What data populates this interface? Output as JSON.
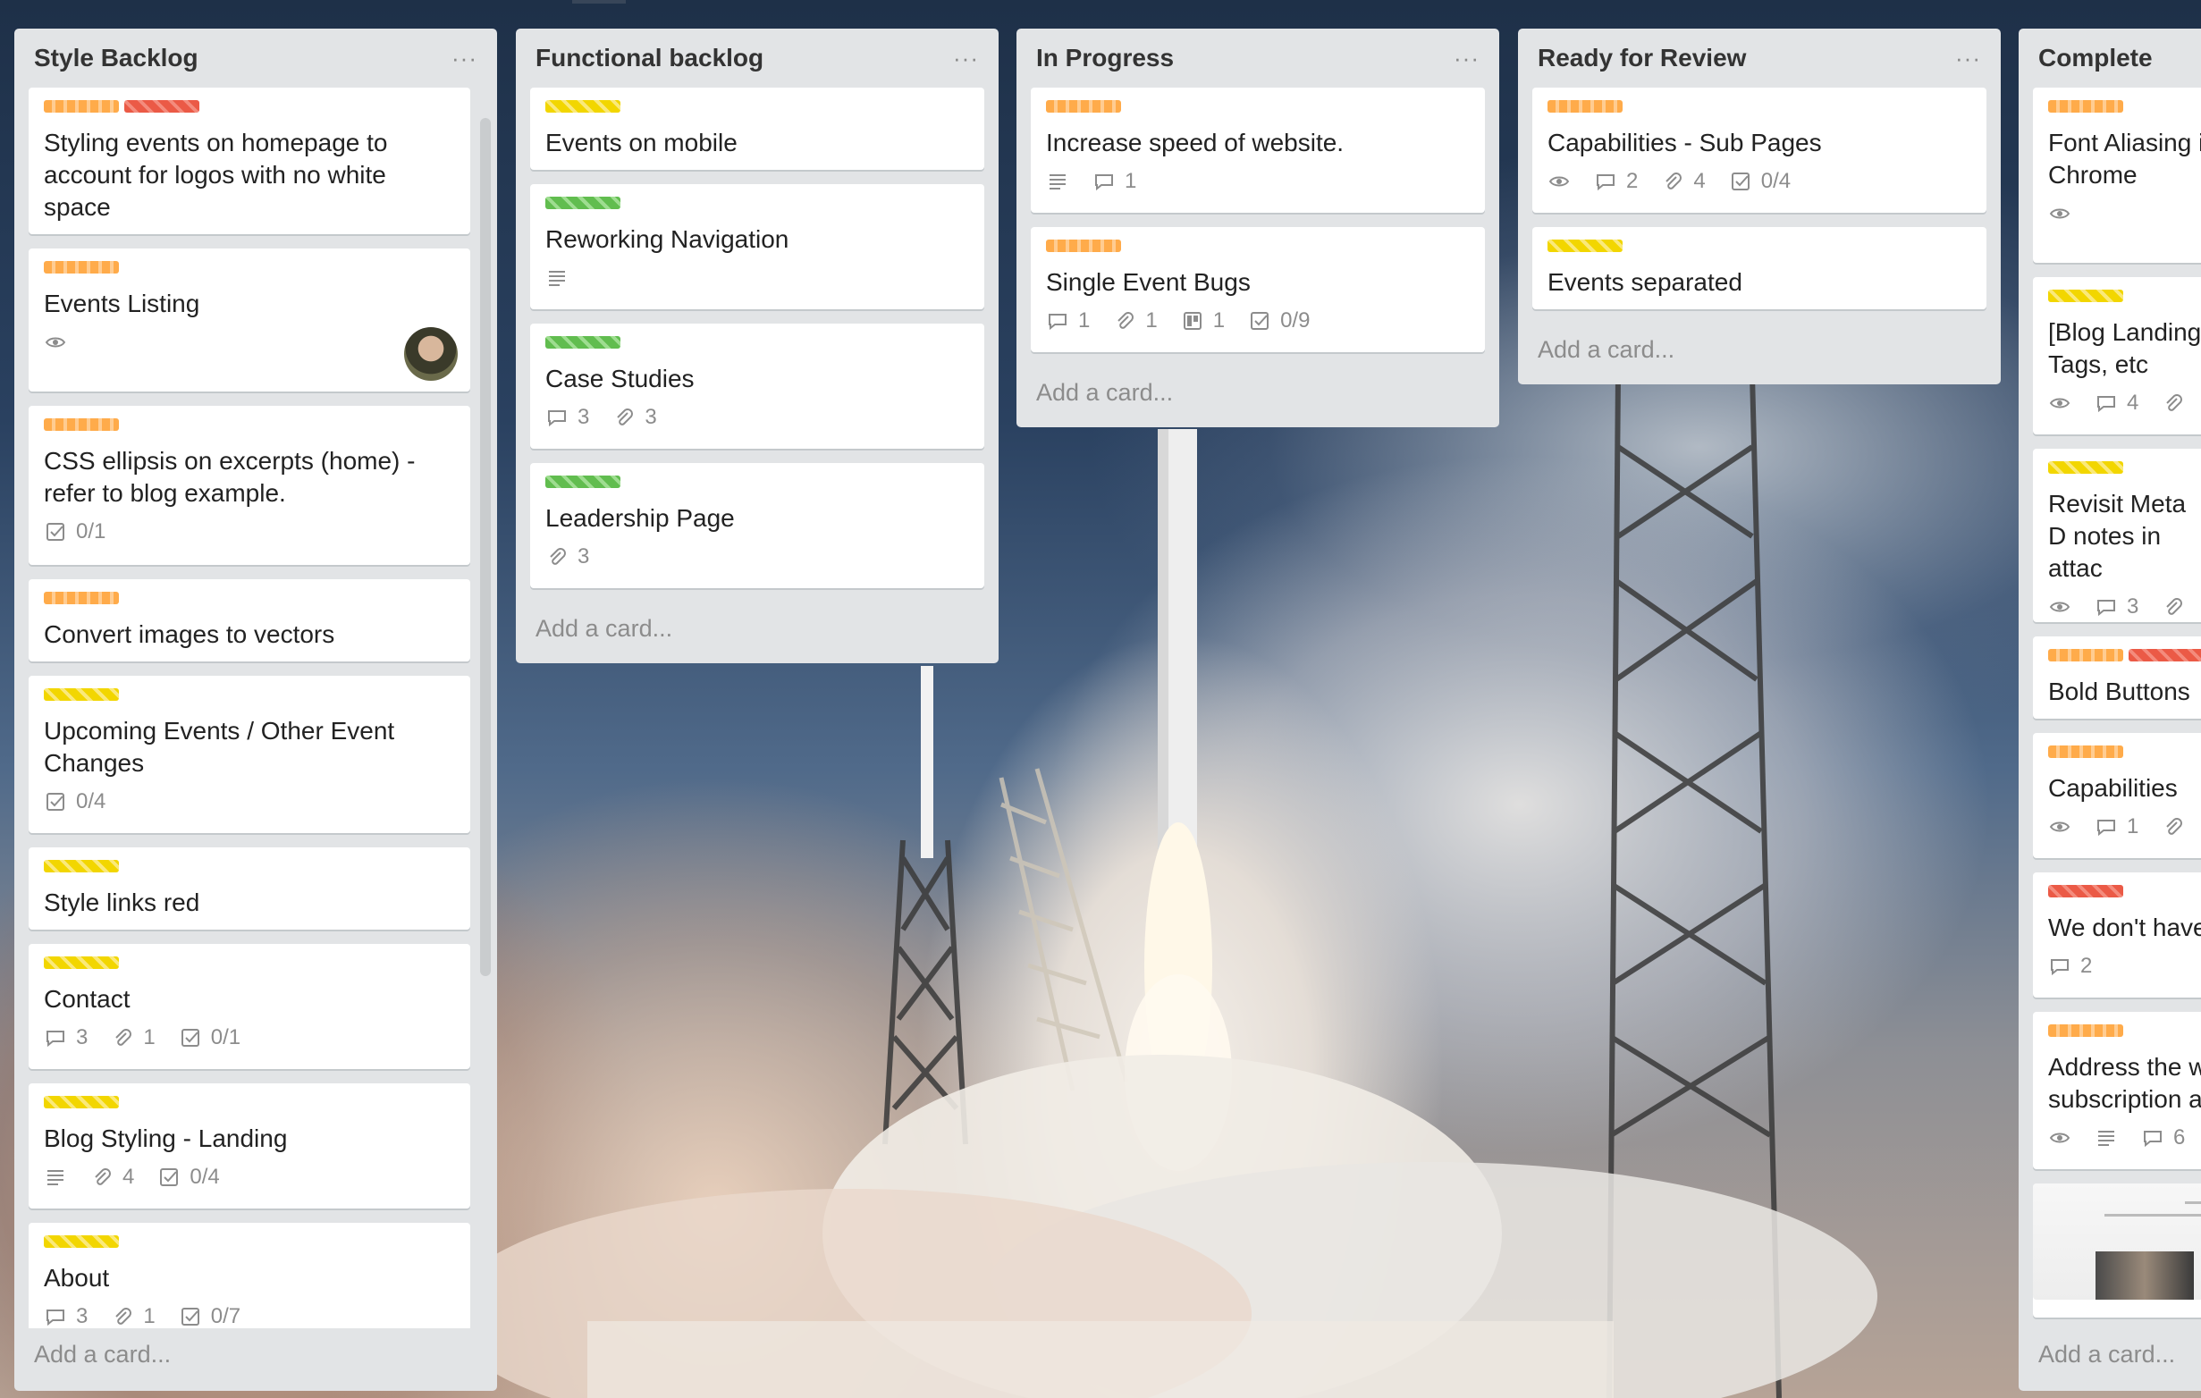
{
  "lists": [
    {
      "title": "Style Backlog",
      "menu": "···",
      "add_card": "Add a card...",
      "cards": [
        {
          "labels": [
            "orange",
            "red"
          ],
          "title": "Styling events on homepage to account for logos with no white space",
          "badges": []
        },
        {
          "labels": [
            "orange"
          ],
          "title": "Events Listing",
          "badges": [
            {
              "icon": "eye-icon",
              "count": ""
            }
          ],
          "avatar": true
        },
        {
          "labels": [
            "orange"
          ],
          "title": "CSS ellipsis on excerpts (home) - refer to blog example.",
          "badges": [
            {
              "icon": "checklist-icon",
              "count": "0/1"
            }
          ]
        },
        {
          "labels": [
            "orange"
          ],
          "title": "Convert images to vectors",
          "badges": []
        },
        {
          "labels": [
            "yellow"
          ],
          "title": "Upcoming Events / Other Event Changes",
          "badges": [
            {
              "icon": "checklist-icon",
              "count": "0/4"
            }
          ]
        },
        {
          "labels": [
            "yellow"
          ],
          "title": "Style links red",
          "badges": []
        },
        {
          "labels": [
            "yellow"
          ],
          "title": "Contact",
          "badges": [
            {
              "icon": "comment-icon",
              "count": "3"
            },
            {
              "icon": "attachment-icon",
              "count": "1"
            },
            {
              "icon": "checklist-icon",
              "count": "0/1"
            }
          ]
        },
        {
          "labels": [
            "yellow"
          ],
          "title": "Blog Styling - Landing",
          "badges": [
            {
              "icon": "description-icon",
              "count": ""
            },
            {
              "icon": "attachment-icon",
              "count": "4"
            },
            {
              "icon": "checklist-icon",
              "count": "0/4"
            }
          ]
        },
        {
          "labels": [
            "yellow"
          ],
          "title": "About",
          "badges": [
            {
              "icon": "comment-icon",
              "count": "3"
            },
            {
              "icon": "attachment-icon",
              "count": "1"
            },
            {
              "icon": "checklist-icon",
              "count": "0/7"
            }
          ]
        }
      ]
    },
    {
      "title": "Functional backlog",
      "menu": "···",
      "add_card": "Add a card...",
      "cards": [
        {
          "labels": [
            "yellow"
          ],
          "title": "Events on mobile",
          "badges": []
        },
        {
          "labels": [
            "green"
          ],
          "title": "Reworking Navigation",
          "badges": [
            {
              "icon": "description-icon",
              "count": ""
            }
          ]
        },
        {
          "labels": [
            "green"
          ],
          "title": "Case Studies",
          "badges": [
            {
              "icon": "comment-icon",
              "count": "3"
            },
            {
              "icon": "attachment-icon",
              "count": "3"
            }
          ]
        },
        {
          "labels": [
            "green"
          ],
          "title": "Leadership Page",
          "badges": [
            {
              "icon": "attachment-icon",
              "count": "3"
            }
          ]
        }
      ]
    },
    {
      "title": "In Progress",
      "menu": "···",
      "add_card": "Add a card...",
      "cards": [
        {
          "labels": [
            "orange"
          ],
          "title": "Increase speed of website.",
          "badges": [
            {
              "icon": "description-icon",
              "count": ""
            },
            {
              "icon": "comment-icon",
              "count": "1"
            }
          ]
        },
        {
          "labels": [
            "orange"
          ],
          "title": "Single Event Bugs",
          "badges": [
            {
              "icon": "comment-icon",
              "count": "1"
            },
            {
              "icon": "attachment-icon",
              "count": "1"
            },
            {
              "icon": "board-icon",
              "count": "1"
            },
            {
              "icon": "checklist-icon",
              "count": "0/9"
            }
          ]
        }
      ]
    },
    {
      "title": "Ready for Review",
      "menu": "···",
      "add_card": "Add a card...",
      "cards": [
        {
          "labels": [
            "orange"
          ],
          "title": "Capabilities - Sub Pages",
          "badges": [
            {
              "icon": "eye-icon",
              "count": ""
            },
            {
              "icon": "comment-icon",
              "count": "2"
            },
            {
              "icon": "attachment-icon",
              "count": "4"
            },
            {
              "icon": "checklist-icon",
              "count": "0/4"
            }
          ]
        },
        {
          "labels": [
            "yellow"
          ],
          "title": "Events separated",
          "badges": []
        }
      ]
    },
    {
      "title": "Complete",
      "menu": "···",
      "add_card": "Add a card...",
      "cards": [
        {
          "labels": [
            "orange"
          ],
          "title": "Font Aliasing i Chrome",
          "badges": [
            {
              "icon": "eye-icon",
              "count": ""
            }
          ]
        },
        {
          "labels": [
            "yellow"
          ],
          "title": "[Blog Landing Tags, etc",
          "badges": [
            {
              "icon": "eye-icon",
              "count": ""
            },
            {
              "icon": "comment-icon",
              "count": "4"
            },
            {
              "icon": "attachment-icon",
              "count": ""
            }
          ]
        },
        {
          "labels": [
            "yellow"
          ],
          "title": "Revisit Meta D notes in attac",
          "badges": [
            {
              "icon": "eye-icon",
              "count": ""
            },
            {
              "icon": "comment-icon",
              "count": "3"
            },
            {
              "icon": "attachment-icon",
              "count": ""
            }
          ]
        },
        {
          "labels": [
            "orange",
            "red"
          ],
          "title": "Bold Buttons",
          "badges": []
        },
        {
          "labels": [
            "orange"
          ],
          "title": "Capabilities",
          "badges": [
            {
              "icon": "eye-icon",
              "count": ""
            },
            {
              "icon": "comment-icon",
              "count": "1"
            },
            {
              "icon": "attachment-icon",
              "count": ""
            }
          ]
        },
        {
          "labels": [
            "red"
          ],
          "title": "We don't have",
          "badges": [
            {
              "icon": "comment-icon",
              "count": "2"
            }
          ]
        },
        {
          "labels": [
            "orange"
          ],
          "title": "Address the w subscription a",
          "badges": [
            {
              "icon": "eye-icon",
              "count": ""
            },
            {
              "icon": "description-icon",
              "count": ""
            },
            {
              "icon": "comment-icon",
              "count": "6"
            }
          ]
        },
        {
          "labels": [],
          "title": "",
          "badges": [],
          "thumbnail": true
        }
      ]
    }
  ],
  "colors": {
    "list_bg": "#e2e4e6",
    "card_bg": "#ffffff",
    "label_orange": "#ffab4a",
    "label_red": "#eb5a46",
    "label_yellow": "#f2d600",
    "label_green": "#61bd4f"
  }
}
